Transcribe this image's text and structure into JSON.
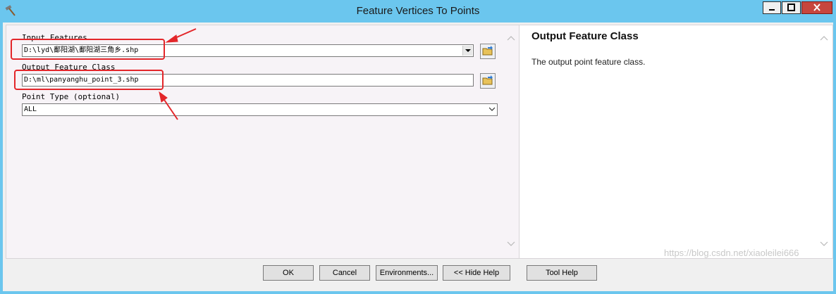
{
  "window": {
    "title": "Feature Vertices To Points",
    "icons": {
      "app": "hammer-icon",
      "minimize": "minimize-icon",
      "maximize": "maximize-icon",
      "close": "close-icon"
    }
  },
  "form": {
    "input_features": {
      "label": "Input Features",
      "value": "D:\\lyd\\鄱阳湖\\鄱阳湖三角乡.shp"
    },
    "output_feature_class": {
      "label": "Output Feature Class",
      "value": "D:\\ml\\panyanghu_point_3.shp"
    },
    "point_type": {
      "label": "Point Type (optional)",
      "value": "ALL"
    }
  },
  "help": {
    "title": "Output Feature Class",
    "body": "The output point feature class."
  },
  "buttons": {
    "ok": "OK",
    "cancel": "Cancel",
    "environments": "Environments...",
    "hide_help": "<< Hide Help",
    "tool_help": "Tool Help"
  },
  "watermark": "https://blog.csdn.net/xiaoleilei666",
  "colors": {
    "titlebar": "#6bc6ee",
    "annotation": "#e3262a",
    "close": "#c7463d"
  }
}
